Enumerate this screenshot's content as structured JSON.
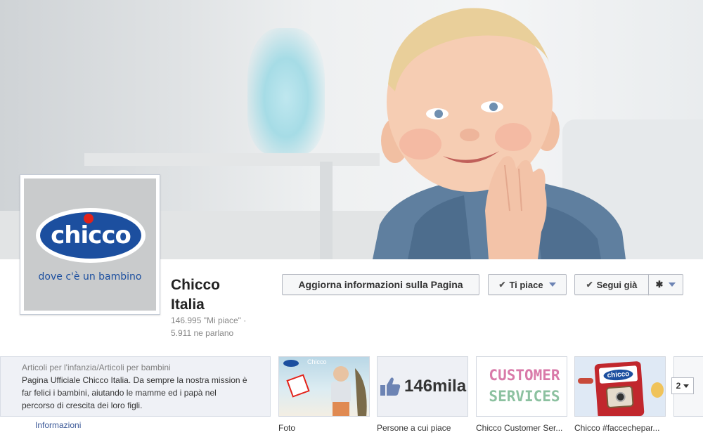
{
  "page": {
    "name_line1": "Chicco",
    "name_line2": "Italia",
    "likes_stat": "146.995 \"Mi piace\" ·",
    "talking_stat": "5.911 ne parlano"
  },
  "profile": {
    "logo_text": "chicco",
    "tagline": "dove c'è un bambino"
  },
  "actions": {
    "update_label": "Aggiorna informazioni sulla Pagina",
    "like_label": "Ti piace",
    "follow_label": "Segui già",
    "check_glyph": "✔",
    "gear_glyph": "✱"
  },
  "about": {
    "category": "Articoli per l'infanzia/Articoli per bambini",
    "description": "Pagina Ufficiale Chicco Italia. Da sempre la nostra mission è far felici i bambini, aiutando le mamme ed i papà nel percorso di crescita dei loro figli.",
    "link_label": "Informazioni"
  },
  "tiles": [
    {
      "label": "Foto",
      "overlay": "Chicco"
    },
    {
      "label": "Persone a cui piace",
      "count": "146mila"
    },
    {
      "label": "Chicco Customer Ser...",
      "line1": "CUSTOMER",
      "line2": "SERVICES"
    },
    {
      "label": "Chicco #faccechepar...",
      "logo_text": "chicco"
    }
  ],
  "more": {
    "count": "2"
  },
  "colors": {
    "brand_blue": "#1c4f9f",
    "brand_red": "#e2231a",
    "facebook_link": "#3b5998"
  }
}
